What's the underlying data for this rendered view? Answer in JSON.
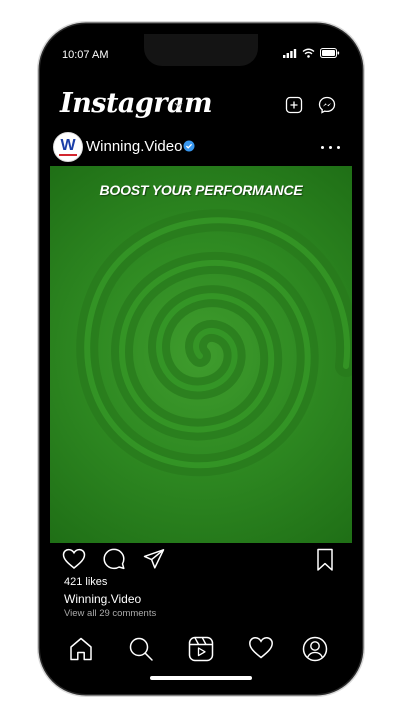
{
  "status_bar": {
    "time": "10:07 AM"
  },
  "app": {
    "name": "Instagram"
  },
  "post": {
    "avatar_letter": "W",
    "username": "Winning.Video",
    "verified": true,
    "image_title": "BOOST YOUR PERFORMANCE",
    "likes": "421 likes",
    "caption_user": "Winning.Video",
    "comments_link": "View all 29 comments"
  },
  "colors": {
    "background": "#000000",
    "image_green": "#2f8a22",
    "verified_blue": "#3897f0",
    "brand_blue": "#1a3ea8",
    "brand_red": "#d2262f"
  },
  "icons": {
    "header": [
      "new-post-icon",
      "messenger-icon"
    ],
    "actions": [
      "heart-icon",
      "comment-icon",
      "share-icon",
      "bookmark-icon"
    ],
    "nav": [
      "home-icon",
      "search-icon",
      "reels-icon",
      "activity-heart-icon",
      "profile-icon"
    ]
  }
}
